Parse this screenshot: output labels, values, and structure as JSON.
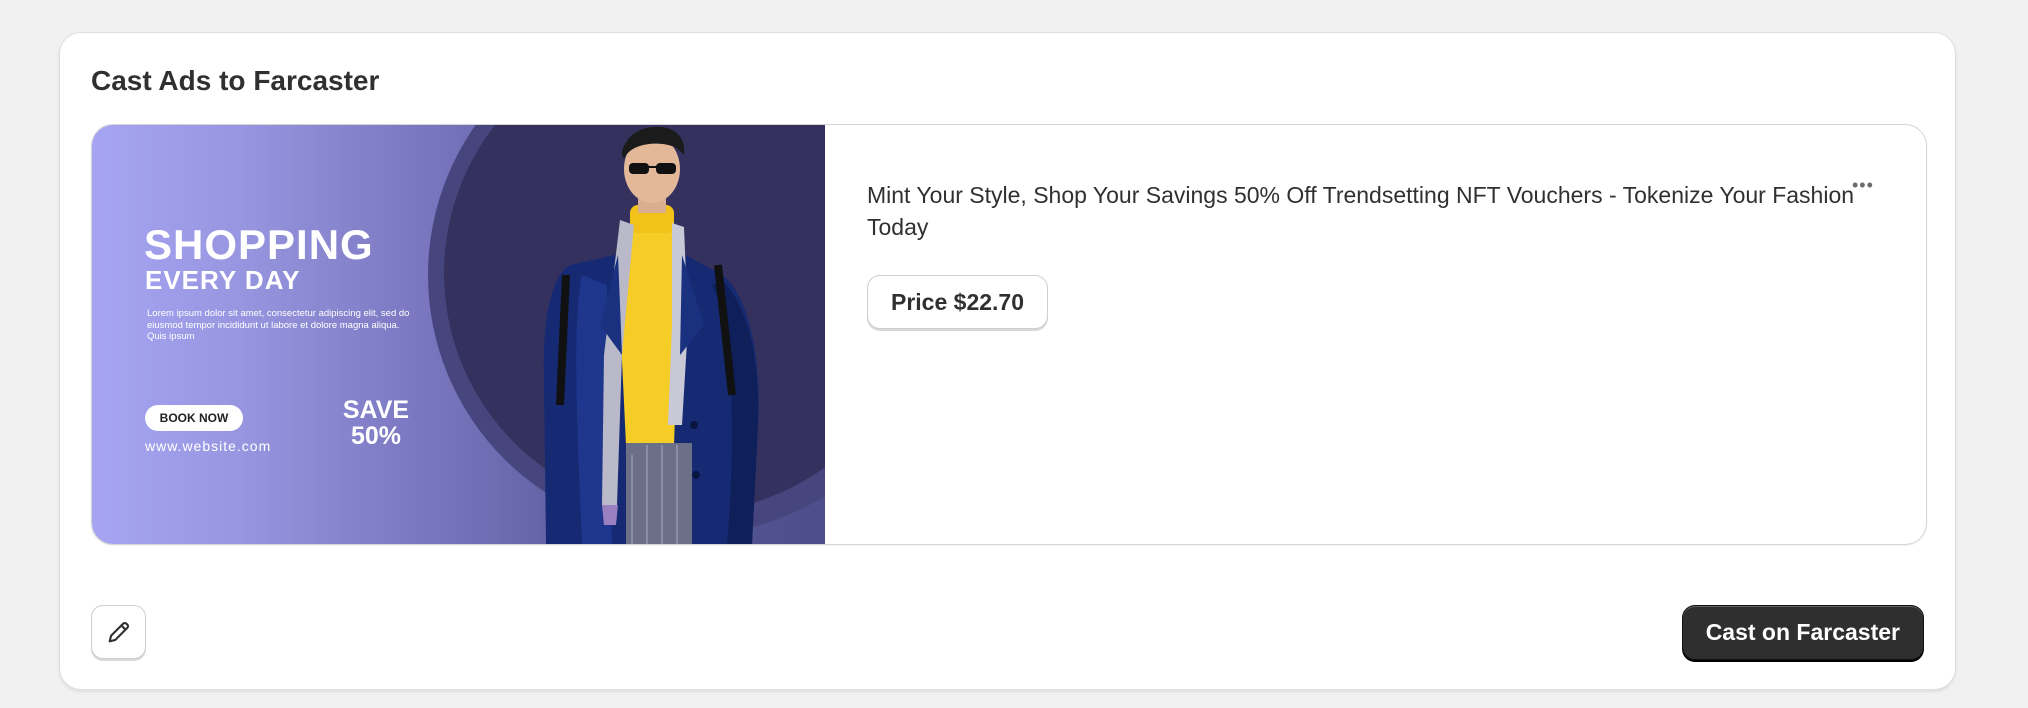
{
  "card": {
    "title": "Cast Ads to Farcaster"
  },
  "banner": {
    "headline": "SHOPPING",
    "subheadline": "EVERY DAY",
    "body": "Lorem ipsum dolor sit amet, consectetur adipiscing elit, sed do eiusmod tempor incididunt ut labore et dolore magna aliqua. Quis ipsum",
    "cta": "BOOK NOW",
    "website": "www.website.com",
    "save": "SAVE\n50%"
  },
  "ad": {
    "text": "Mint Your Style, Shop Your Savings 50% Off Trendsetting NFT Vouchers - Tokenize Your Fashion Today",
    "price_label": "Price $22.70",
    "more_icon": "more-horizontal-icon"
  },
  "footer": {
    "edit_icon": "pencil-icon",
    "cast_label": "Cast on Farcaster"
  }
}
